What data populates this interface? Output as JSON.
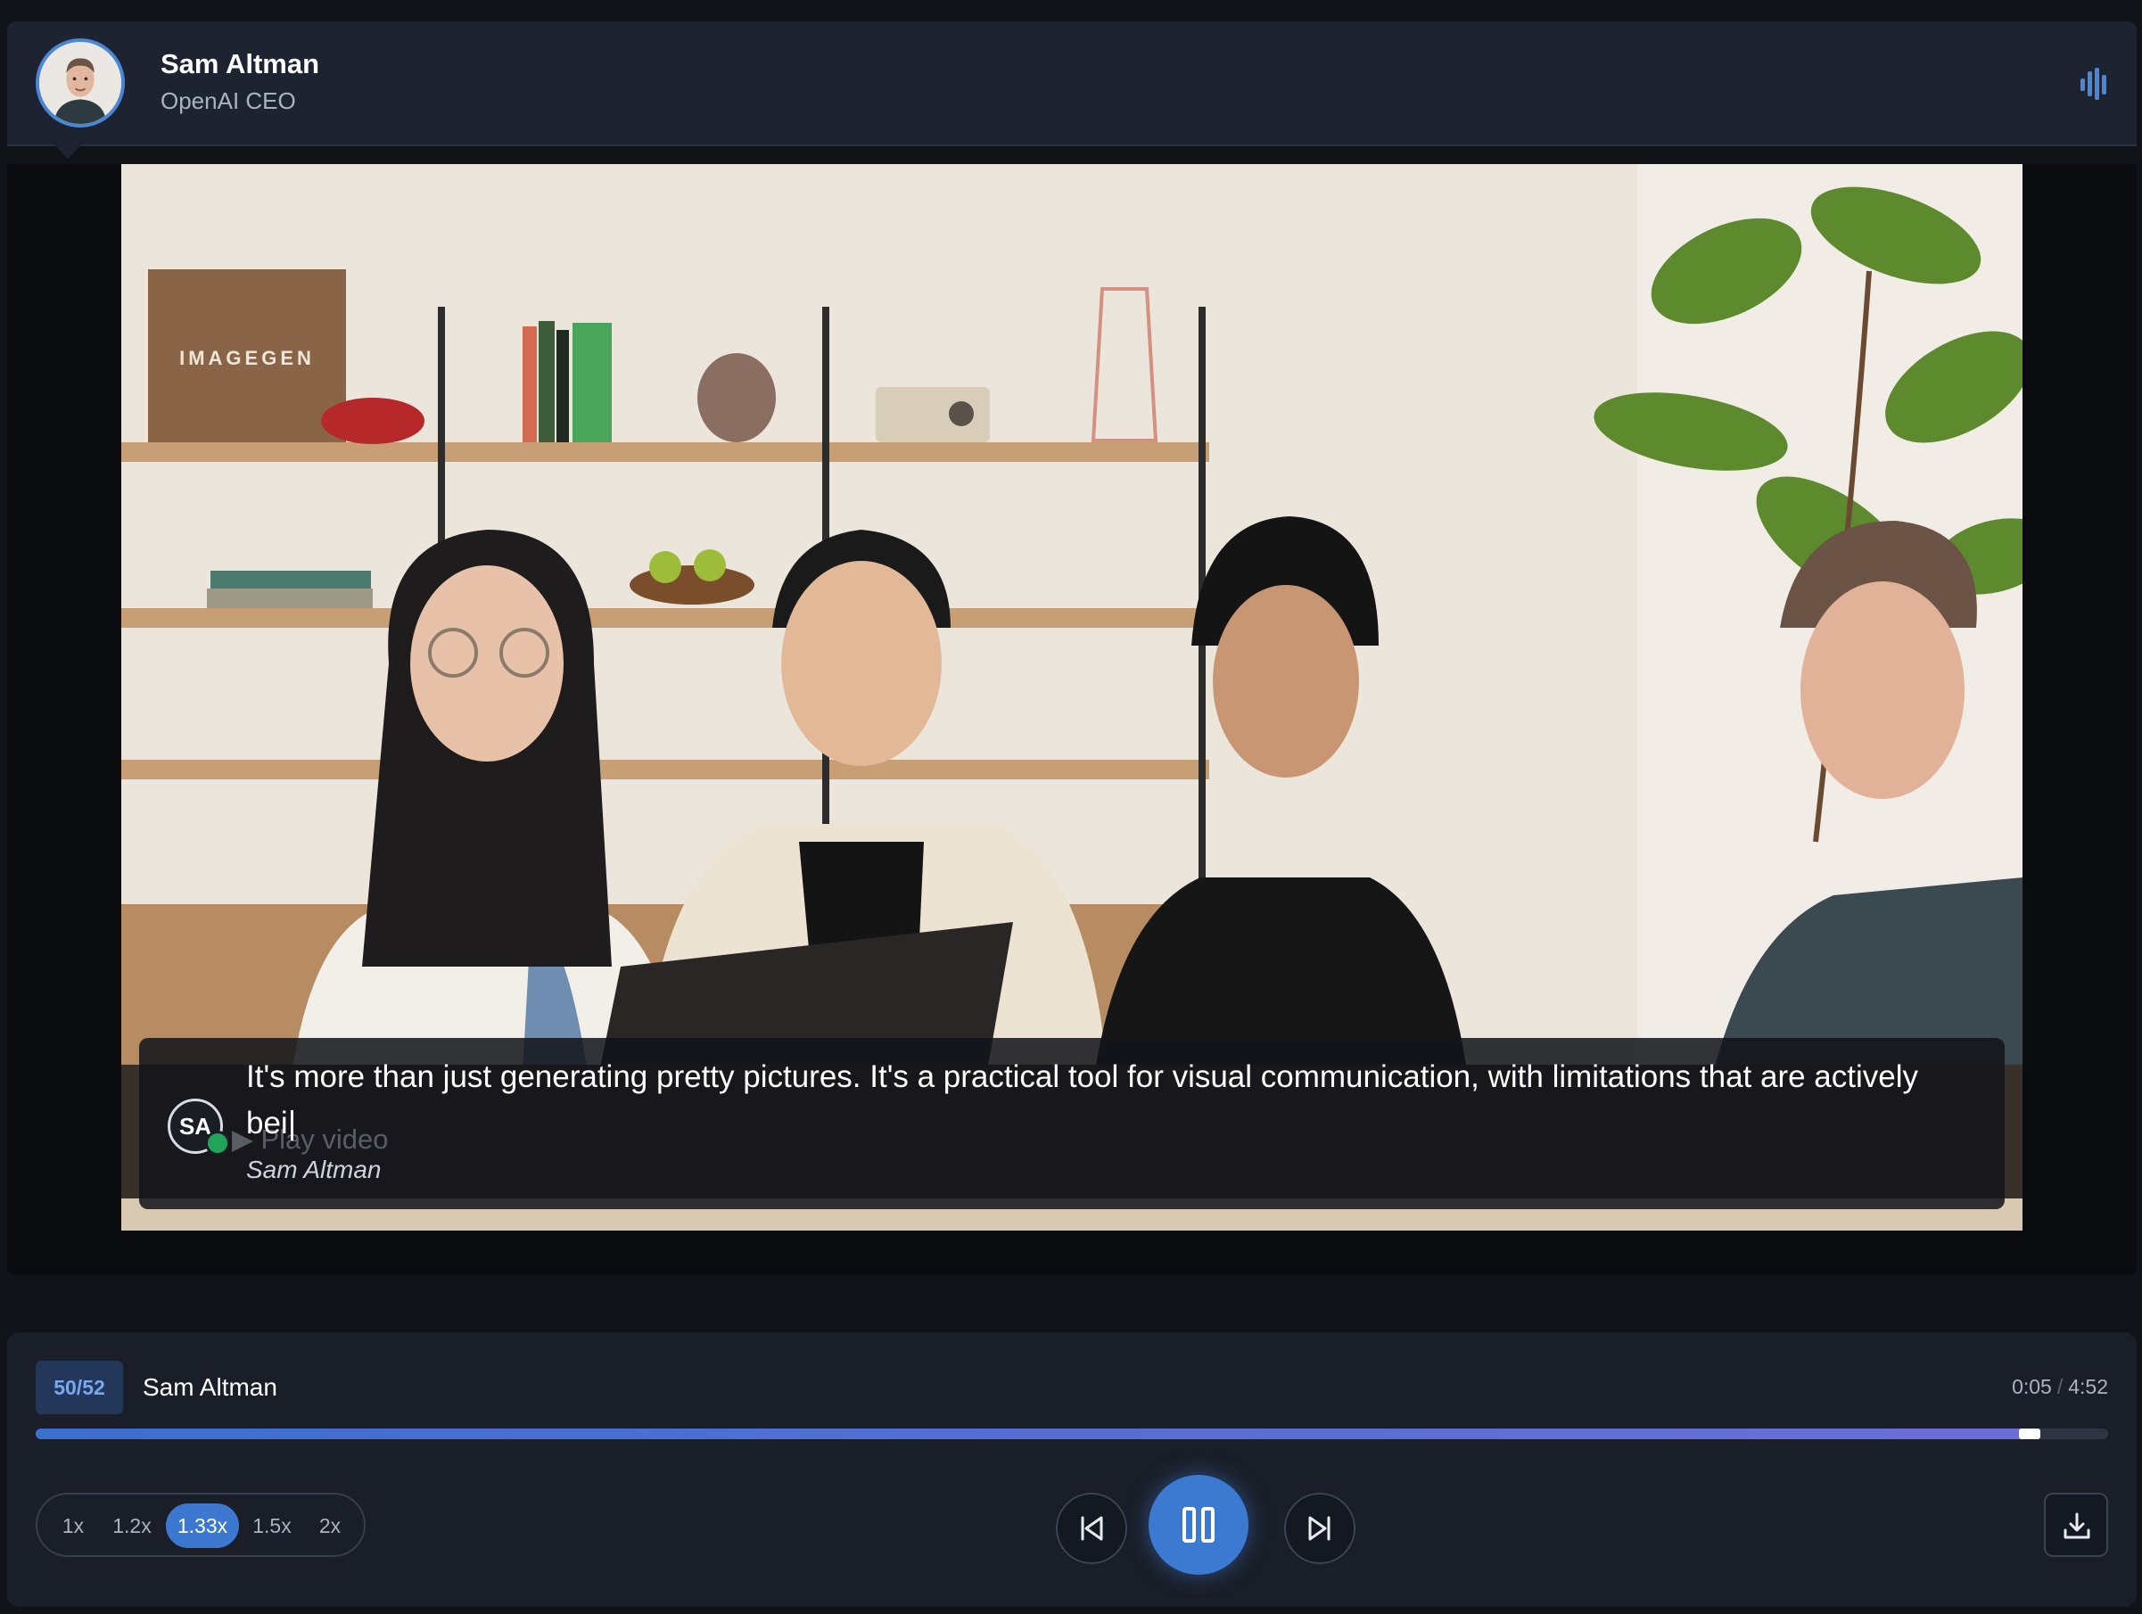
{
  "header": {
    "name": "Sam Altman",
    "role": "OpenAI CEO"
  },
  "video": {
    "scene_sign_text": "IMAGEGEN",
    "caption": {
      "avatar_initials": "SA",
      "play_label": "▶ Play video",
      "text": "It's more than just generating pretty pictures. It's a practical tool for visual communication, with limitations that are actively bei",
      "speaker": "Sam Altman"
    }
  },
  "player": {
    "counter": "50/52",
    "speaker": "Sam Altman",
    "time_current": "0:05",
    "time_separator": "/",
    "time_total": "4:52",
    "progress_fraction": 0.962,
    "speeds": [
      "1x",
      "1.2x",
      "1.33x",
      "1.5x",
      "2x"
    ],
    "active_speed": "1.33x"
  },
  "colors": {
    "accent": "#3c7ad2",
    "panel": "#1d2331",
    "background": "#101318"
  }
}
